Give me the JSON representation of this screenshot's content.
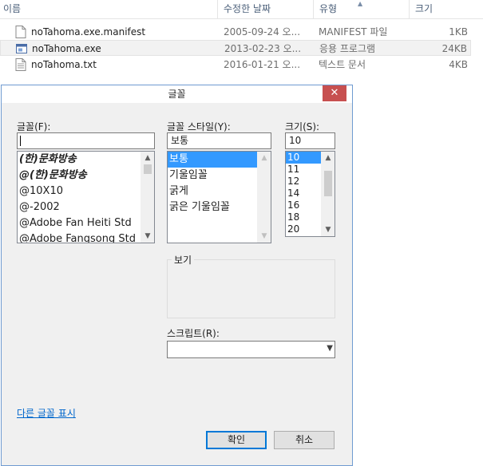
{
  "explorer": {
    "columns": {
      "name": "이름",
      "date": "수정한 날짜",
      "type": "유형",
      "size": "크기"
    },
    "files": [
      {
        "name": "noTahoma.exe.manifest",
        "date": "2005-09-24 오...",
        "type": "MANIFEST 파일",
        "size": "1KB",
        "icon": "document-icon"
      },
      {
        "name": "noTahoma.exe",
        "date": "2013-02-23 오...",
        "type": "응용 프로그램",
        "size": "24KB",
        "icon": "application-icon"
      },
      {
        "name": "noTahoma.txt",
        "date": "2016-01-21 오...",
        "type": "텍스트 문서",
        "size": "4KB",
        "icon": "text-document-icon"
      }
    ]
  },
  "dialog": {
    "title": "글꼴",
    "close_glyph": "✕",
    "font_label": "글꼴(F):",
    "font_value": "",
    "fonts": [
      "(한)문화방송",
      "@(한)문화방송",
      "@10X10",
      "@-2002",
      "@Adobe Fan Heiti Std",
      "@Adobe Fangsong Std"
    ],
    "style_label": "글꼴 스타일(Y):",
    "style_value": "보통",
    "styles": [
      "보통",
      "기울임꼴",
      "굵게",
      "굵은 기울임꼴"
    ],
    "size_label": "크기(S):",
    "size_value": "10",
    "sizes": [
      "10",
      "11",
      "12",
      "14",
      "16",
      "18",
      "20"
    ],
    "preview_label": "보기",
    "script_label": "스크립트(R):",
    "script_value": "",
    "more_fonts_link": "다른 글꼴 표시",
    "ok_label": "확인",
    "cancel_label": "취소"
  },
  "colors": {
    "accent": "#0078d7",
    "selection": "#3399ff",
    "close": "#c75050",
    "link": "#0066cc"
  }
}
